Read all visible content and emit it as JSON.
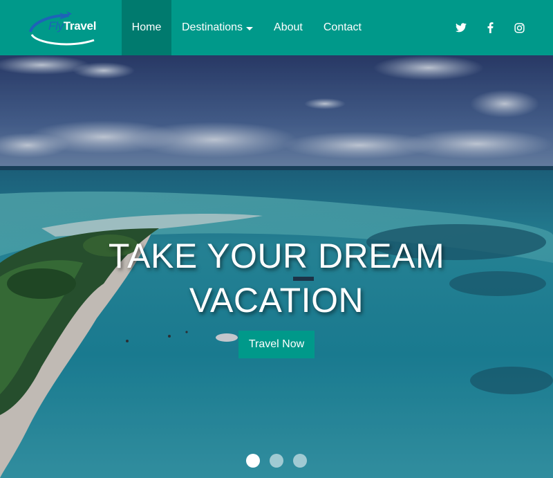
{
  "brand": {
    "fly": "Fly",
    "travel": "Travel"
  },
  "nav": {
    "items": [
      {
        "label": "Home",
        "active": true
      },
      {
        "label": "Destinations",
        "dropdown": true
      },
      {
        "label": "About"
      },
      {
        "label": "Contact"
      }
    ]
  },
  "social": [
    "twitter-icon",
    "facebook-icon",
    "instagram-icon"
  ],
  "hero": {
    "title_line1": "TAKE YOUR DREAM",
    "title_line2": "VACATION",
    "cta_label": "Travel Now"
  },
  "carousel": {
    "slides": 3,
    "active_index": 0
  },
  "colors": {
    "brand": "#00998a",
    "brand_active": "#007a6e",
    "logo_blue": "#1e63b8"
  }
}
